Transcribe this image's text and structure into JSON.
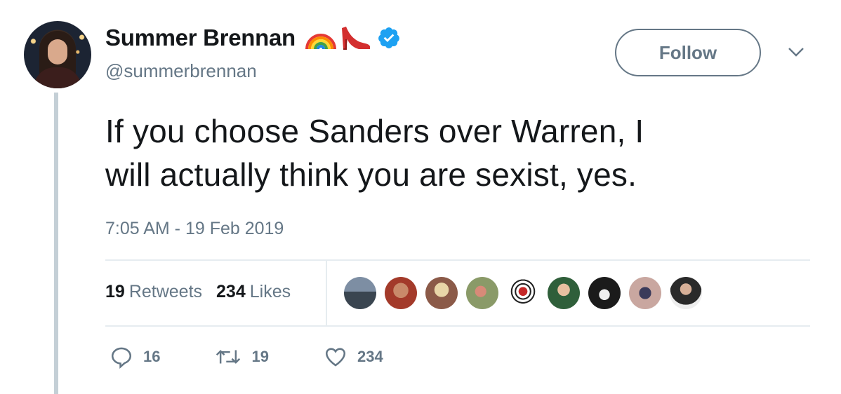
{
  "author": {
    "name": "Summer Brennan",
    "handle": "@summerbrennan",
    "emojis": [
      "rainbow-emoji",
      "high-heel-emoji"
    ],
    "verified": true
  },
  "follow_button": {
    "label": "Follow"
  },
  "tweet": {
    "text_line1": "If you choose Sanders over Warren, I",
    "text_line2": "will actually think you are sexist, yes.",
    "timestamp": "7:05 AM - 19 Feb 2019"
  },
  "stats": {
    "retweets_count": "19",
    "retweets_label": "Retweets",
    "likes_count": "234",
    "likes_label": "Likes"
  },
  "likers": [
    {
      "name": "liker-avatar-1"
    },
    {
      "name": "liker-avatar-2"
    },
    {
      "name": "liker-avatar-3"
    },
    {
      "name": "liker-avatar-4"
    },
    {
      "name": "liker-avatar-5"
    },
    {
      "name": "liker-avatar-6"
    },
    {
      "name": "liker-avatar-7"
    },
    {
      "name": "liker-avatar-8"
    },
    {
      "name": "liker-avatar-9"
    }
  ],
  "actions": {
    "reply_count": "16",
    "retweet_count": "19",
    "like_count": "234"
  },
  "colors": {
    "text": "#14171a",
    "muted": "#657786",
    "verified_blue": "#1da1f2",
    "divider": "#e6ecf0"
  }
}
